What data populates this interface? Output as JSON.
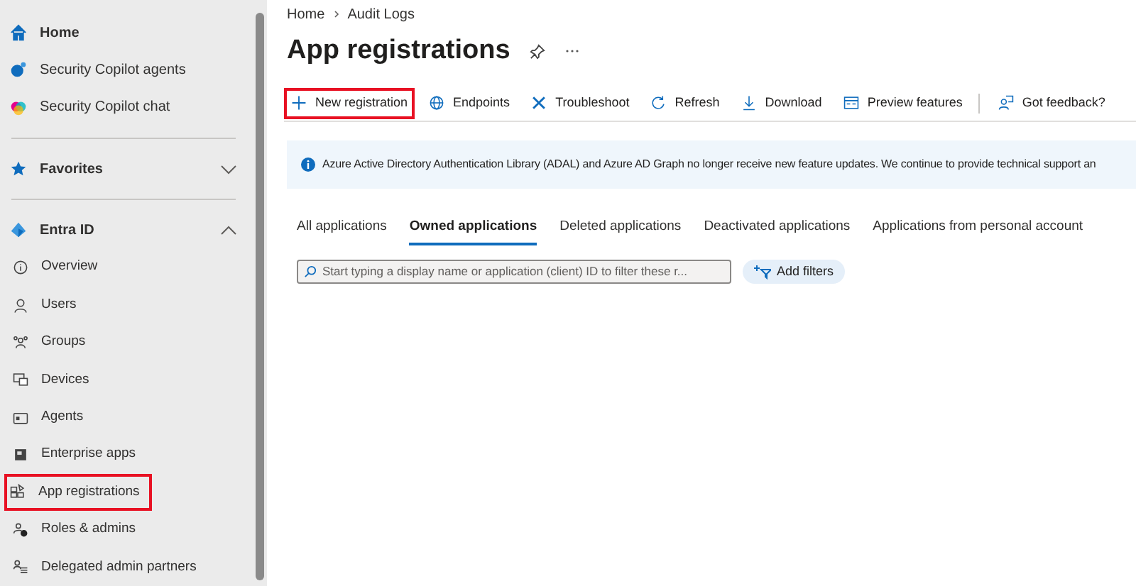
{
  "sidebar": {
    "items": [
      {
        "kind": "link",
        "label": "Home"
      },
      {
        "kind": "link",
        "label": "Security Copilot agents"
      },
      {
        "kind": "link",
        "label": "Security Copilot chat"
      },
      {
        "kind": "divider"
      },
      {
        "kind": "section",
        "label": "Favorites",
        "expanded": false
      },
      {
        "kind": "divider"
      },
      {
        "kind": "section",
        "label": "Entra ID",
        "expanded": true,
        "children": [
          {
            "label": "Overview",
            "highlighted": false
          },
          {
            "label": "Users",
            "highlighted": false
          },
          {
            "label": "Groups",
            "highlighted": false
          },
          {
            "label": "Devices",
            "highlighted": false
          },
          {
            "label": "Agents",
            "highlighted": false
          },
          {
            "label": "Enterprise apps",
            "highlighted": false
          },
          {
            "label": "App registrations",
            "highlighted": true
          },
          {
            "label": "Roles & admins",
            "highlighted": false
          },
          {
            "label": "Delegated admin partners",
            "highlighted": false
          }
        ]
      }
    ]
  },
  "breadcrumb": [
    "Home",
    "Audit Logs"
  ],
  "page_title": "App registrations",
  "toolbar": [
    {
      "label": "New registration",
      "highlighted": true
    },
    {
      "label": "Endpoints",
      "highlighted": false
    },
    {
      "label": "Troubleshoot",
      "highlighted": false
    },
    {
      "label": "Refresh",
      "highlighted": false
    },
    {
      "label": "Download",
      "highlighted": false
    },
    {
      "label": "Preview features",
      "highlighted": false
    },
    {
      "label": "Got feedback?",
      "highlighted": false
    }
  ],
  "banner": "Azure Active Directory Authentication Library (ADAL) and Azure AD Graph no longer receive new feature updates. We continue to provide technical support an",
  "tabs": [
    {
      "label": "All applications",
      "selected": false
    },
    {
      "label": "Owned applications",
      "selected": true
    },
    {
      "label": "Deleted applications",
      "selected": false
    },
    {
      "label": "Deactivated applications",
      "selected": false
    },
    {
      "label": "Applications from personal account",
      "selected": false
    }
  ],
  "search": {
    "placeholder": "Start typing a display name or application (client) ID to filter these r..."
  },
  "filter_button": "Add filters"
}
